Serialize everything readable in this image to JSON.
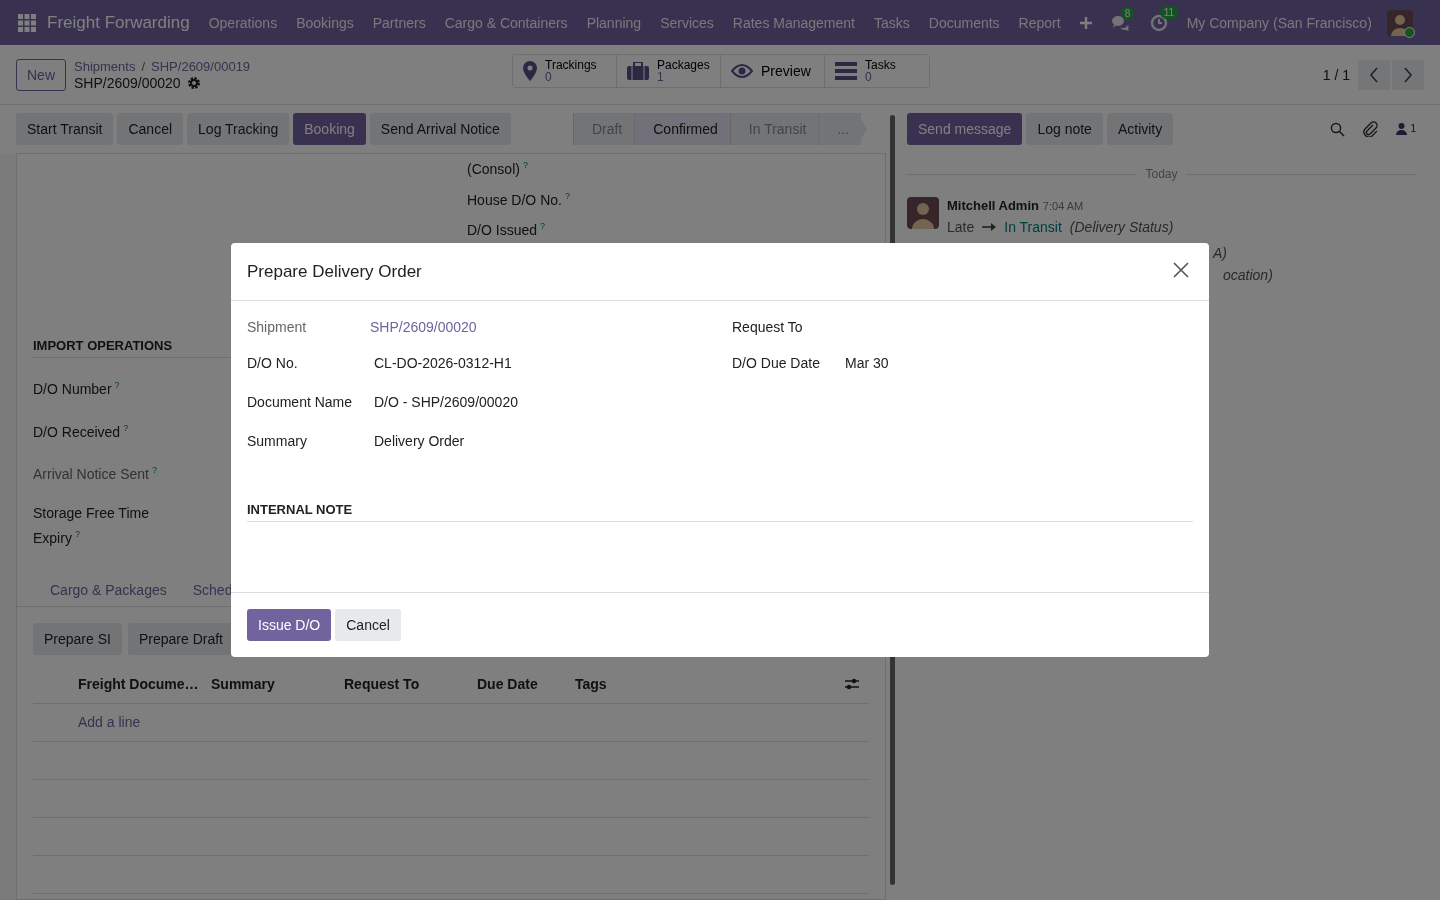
{
  "navbar": {
    "app_name": "Freight Forwarding",
    "menus": [
      "Operations",
      "Bookings",
      "Partners",
      "Cargo & Containers",
      "Planning",
      "Services",
      "Rates Management",
      "Tasks",
      "Documents",
      "Report"
    ],
    "messages_badge": "8",
    "activities_badge": "11",
    "company": "My Company (San Francisco)"
  },
  "control_panel": {
    "new_button": "New",
    "breadcrumbs": [
      "Shipments",
      "SHP/2609/00019"
    ],
    "record": "SHP/2609/00020",
    "breadcrumb_separator": "/",
    "smart_buttons": [
      {
        "kind": "stat",
        "label": "Trackings",
        "value": "0"
      },
      {
        "kind": "stat",
        "label": "Packages",
        "value": "1"
      },
      {
        "kind": "plain",
        "label": "Preview"
      },
      {
        "kind": "stat",
        "label": "Tasks",
        "value": "0"
      }
    ],
    "pager": "1 / 1"
  },
  "action_buttons": [
    {
      "label": "Start Transit",
      "primary": false
    },
    {
      "label": "Cancel",
      "primary": false
    },
    {
      "label": "Log Tracking",
      "primary": false
    },
    {
      "label": "Booking",
      "primary": true
    },
    {
      "label": "Send Arrival Notice",
      "primary": false
    }
  ],
  "status_bar": [
    {
      "label": "Draft",
      "selected": false
    },
    {
      "label": "Confirmed",
      "selected": true
    },
    {
      "label": "In Transit",
      "selected": false
    },
    {
      "label": "...",
      "selected": false
    }
  ],
  "form": {
    "right_fields": [
      {
        "label": "(Consol)",
        "help": "?"
      },
      {
        "label": "House D/O No.",
        "help": "?"
      },
      {
        "label": "D/O Issued",
        "help": "?"
      }
    ],
    "section_title": "IMPORT OPERATIONS",
    "fields": [
      {
        "label": "D/O Number",
        "help": "?",
        "readonly": false
      },
      {
        "label": "D/O Received",
        "help": "?",
        "readonly": false
      },
      {
        "label": "Arrival Notice Sent",
        "help": "?",
        "readonly": true
      },
      {
        "label": "Storage Free Time Expiry",
        "help": "?",
        "readonly": false
      }
    ],
    "tabs": [
      {
        "label": "Cargo & Packages",
        "selected": false
      },
      {
        "label": "Sched",
        "selected": false
      }
    ],
    "list_buttons": [
      "Prepare SI",
      "Prepare Draft"
    ],
    "table": {
      "columns": [
        "Freight Docume…",
        "Summary",
        "Request To",
        "Due Date",
        "Tags"
      ],
      "add_line": "Add a line"
    }
  },
  "chatter": {
    "buttons": [
      {
        "label": "Send message",
        "primary": true
      },
      {
        "label": "Log note",
        "primary": false
      },
      {
        "label": "Activity",
        "primary": false
      }
    ],
    "followers": "1",
    "date_separator": "Today",
    "message": {
      "author": "Mitchell Admin",
      "time": "7:04 AM",
      "old_value": "Late",
      "new_value": "In Transit",
      "field": "(Delivery Status)"
    },
    "fragments": [
      "A)",
      "ocation)"
    ]
  },
  "dialog": {
    "title": "Prepare Delivery Order",
    "left_fields": [
      {
        "label": "Shipment",
        "value": "SHP/2609/00020",
        "kind": "link"
      },
      {
        "label": "D/O No.",
        "value": "CL-DO-2026-0312-H1",
        "kind": "text"
      },
      {
        "label": "Document Name",
        "value": "D/O - SHP/2609/00020",
        "kind": "text"
      },
      {
        "label": "Summary",
        "value": "Delivery Order",
        "kind": "text"
      }
    ],
    "right_fields": [
      {
        "label": "Request To"
      },
      {
        "label": "D/O Due Date",
        "value": "Mar 30"
      }
    ],
    "note_title": "INTERNAL NOTE",
    "buttons": [
      {
        "label": "Issue D/O",
        "primary": true
      },
      {
        "label": "Cancel",
        "primary": false
      }
    ]
  }
}
